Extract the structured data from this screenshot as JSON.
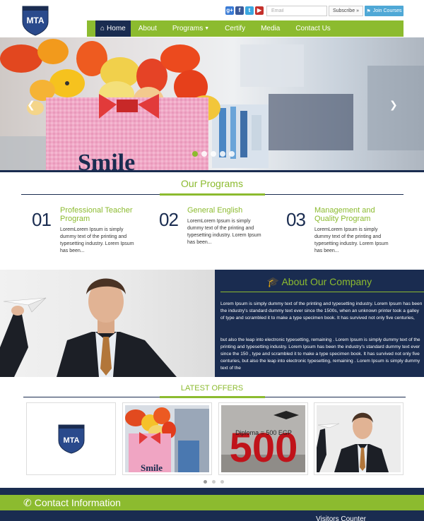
{
  "brand": {
    "logo_text": "MTA"
  },
  "header": {
    "social": [
      {
        "name": "google-plus-icon",
        "glyph": "g+"
      },
      {
        "name": "facebook-icon",
        "glyph": "f"
      },
      {
        "name": "twitter-icon",
        "glyph": "t"
      },
      {
        "name": "youtube-icon",
        "glyph": "▶"
      }
    ],
    "email_placeholder": "Email",
    "subscribe_label": "Subscribe",
    "join_label": "Join Courses"
  },
  "nav": {
    "items": [
      {
        "label": "Home",
        "active": true
      },
      {
        "label": "About"
      },
      {
        "label": "Programs"
      },
      {
        "label": "Certify"
      },
      {
        "label": "Media"
      },
      {
        "label": "Contact Us"
      }
    ]
  },
  "hero": {
    "slide_count": 5,
    "active_slide": 1,
    "caption_text": "Smile"
  },
  "programs": {
    "title": "Our Programs",
    "items": [
      {
        "number": "01",
        "title": "Professional Teacher Program",
        "text": "LoremLorem Ipsum is simply dummy text of the printing and typesetting industry. Lorem Ipsum has been..."
      },
      {
        "number": "02",
        "title": "General English",
        "text": "LoremLorem Ipsum is simply dummy text of the printing and typesetting industry. Lorem Ipsum has been..."
      },
      {
        "number": "03",
        "title": "Management and Quality Program",
        "text": "LoremLorem Ipsum is simply dummy text of the printing and typesetting industry. Lorem Ipsum has been..."
      }
    ]
  },
  "about": {
    "title": "About Our Company",
    "paragraph1": "Lorem Ipsum is simply dummy text of the printing and typesetting industry. Lorem Ipsum has been the industry's standard dummy text ever since the 1500s, when an unknown printer took a galley of type and scrambled it to make a type specimen book. It has survived not only five centuries,",
    "paragraph2": "but also the leap into electronic typesetting, remaining . Lorem Ipsum is simply dummy text of the printing and typesetting industry. Lorem Ipsum has been the industry's standard dummy text ever since the 150 , type and scrambled it to make a type specimen book. It has survived not only five centuries, but also the leap into electronic typesetting, remaining . Lorem Ipsum is simply dummy text of the"
  },
  "offers": {
    "title": "LATEST OFFERS",
    "promo_text": "Diploma = 500 EGP",
    "promo_number": "500",
    "dot_count": 3,
    "active_dot": 0
  },
  "footer": {
    "contact_title": "Contact Information",
    "visitors_title": "Visitors Counter"
  },
  "colors": {
    "navy": "#1a2c50",
    "green": "#8cbb2f",
    "blue": "#4fa8d6"
  }
}
